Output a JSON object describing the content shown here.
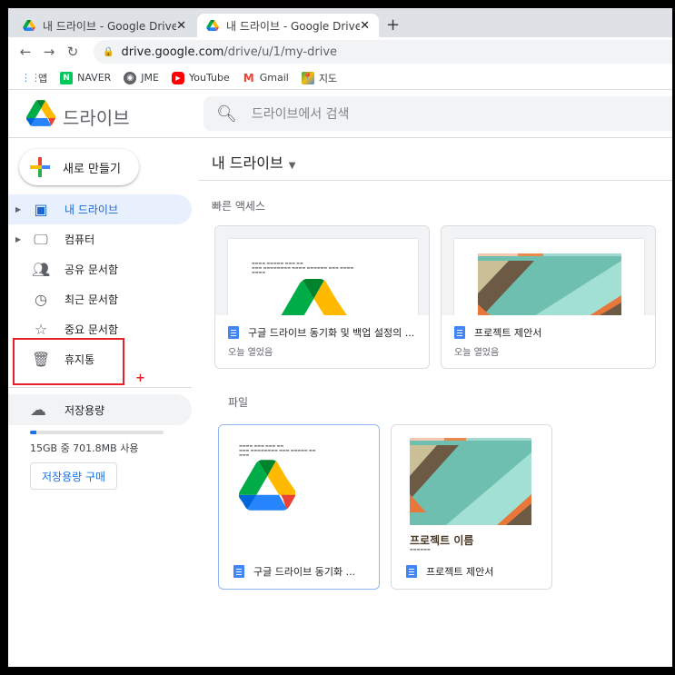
{
  "browser": {
    "tabs": [
      {
        "title": "내 드라이브 - Google Drive",
        "close": "✕"
      },
      {
        "title": "내 드라이브 - Google Drive",
        "close": "✕"
      }
    ],
    "new_tab": "+",
    "url_host": "drive.google.com",
    "url_path": "/drive/u/1/my-drive",
    "bookmarks": [
      {
        "label": "앱",
        "icon": "apps-grid-icon",
        "color": "#4285f4"
      },
      {
        "label": "NAVER",
        "icon": "naver-icon",
        "color": "#03c75a"
      },
      {
        "label": "JME",
        "icon": "globe-icon",
        "color": "#5f6368"
      },
      {
        "label": "YouTube",
        "icon": "youtube-icon",
        "color": "#ff0000"
      },
      {
        "label": "Gmail",
        "icon": "gmail-icon",
        "color": "#ea4335"
      },
      {
        "label": "지도",
        "icon": "maps-icon",
        "color": "#34a853"
      }
    ]
  },
  "drive": {
    "brand": "드라이브",
    "search_placeholder": "드라이브에서 검색"
  },
  "sidebar": {
    "new_button": "새로 만들기",
    "items": [
      {
        "label": "내 드라이브",
        "icon": "my-drive-icon",
        "selected": true
      },
      {
        "label": "컴퓨터",
        "icon": "computer-icon"
      },
      {
        "label": "공유 문서함",
        "icon": "shared-icon"
      },
      {
        "label": "최근 문서함",
        "icon": "clock-icon"
      },
      {
        "label": "중요 문서함",
        "icon": "star-icon"
      },
      {
        "label": "휴지통",
        "icon": "trash-icon"
      }
    ],
    "storage_label": "저장용량",
    "storage_used_fraction": 0.046,
    "storage_text": "15GB 중 701.8MB 사용",
    "buy_storage": "저장용량 구매"
  },
  "main": {
    "title": "내 드라이브",
    "quick_access_label": "빠른 액세스",
    "quick_access": [
      {
        "name": "구글 드라이브 동기화 및 백업 설정의 ...",
        "meta": "오늘 열었음"
      },
      {
        "name": "프로젝트 제안서",
        "meta": "오늘 열었음"
      }
    ],
    "files_label": "파일",
    "files": [
      {
        "name": "구글 드라이브 동기화 ..."
      },
      {
        "name": "프로젝트 제안서",
        "preview_title": "프로젝트 이름"
      }
    ]
  },
  "colors": {
    "accent_blue": "#1a73e8",
    "selected_bg": "#e8f0fe",
    "annotation_red": "#e8202a"
  }
}
